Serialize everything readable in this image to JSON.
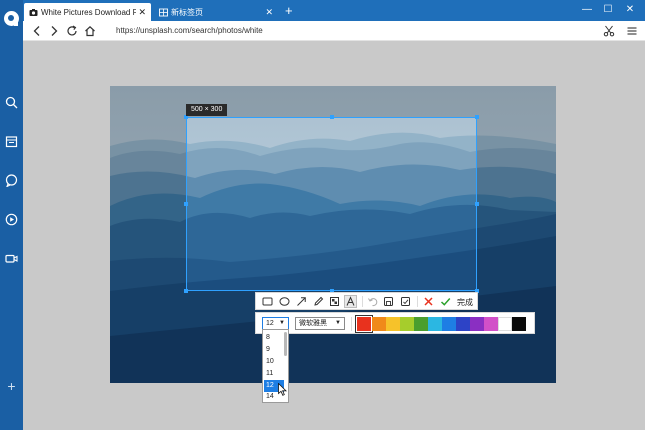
{
  "browser": {
    "tabs": [
      {
        "title": "White Pictures Download Free",
        "close": "✕"
      },
      {
        "title": "新标签页",
        "close": "✕"
      }
    ],
    "new_tab": "+",
    "window_controls": {
      "minimize": "—",
      "maximize": "☐",
      "close": "✕"
    },
    "url": "https://unsplash.com/search/photos/white"
  },
  "sidebar": {
    "icons": [
      "logo-icon",
      "search-icon",
      "calendar-icon",
      "chat-icon",
      "play-icon",
      "video-icon",
      "add-icon"
    ],
    "add_label": "+"
  },
  "screenshot_tool": {
    "size_label": "500 × 300",
    "done_label": "完成",
    "font_size": "12",
    "font_name": "微软雅黑",
    "font_size_options": [
      "8",
      "9",
      "10",
      "11",
      "12",
      "14"
    ],
    "selected_font_size": "12",
    "colors": [
      "#e8321e",
      "#f08a1a",
      "#f6c22a",
      "#a6cd2c",
      "#4a9e2e",
      "#2bb7e2",
      "#1e7ee4",
      "#2d43c6",
      "#8a2fc2",
      "#d250c8",
      "#ffffff",
      "#0a0a0a"
    ],
    "selected_color": "#e8321e"
  }
}
